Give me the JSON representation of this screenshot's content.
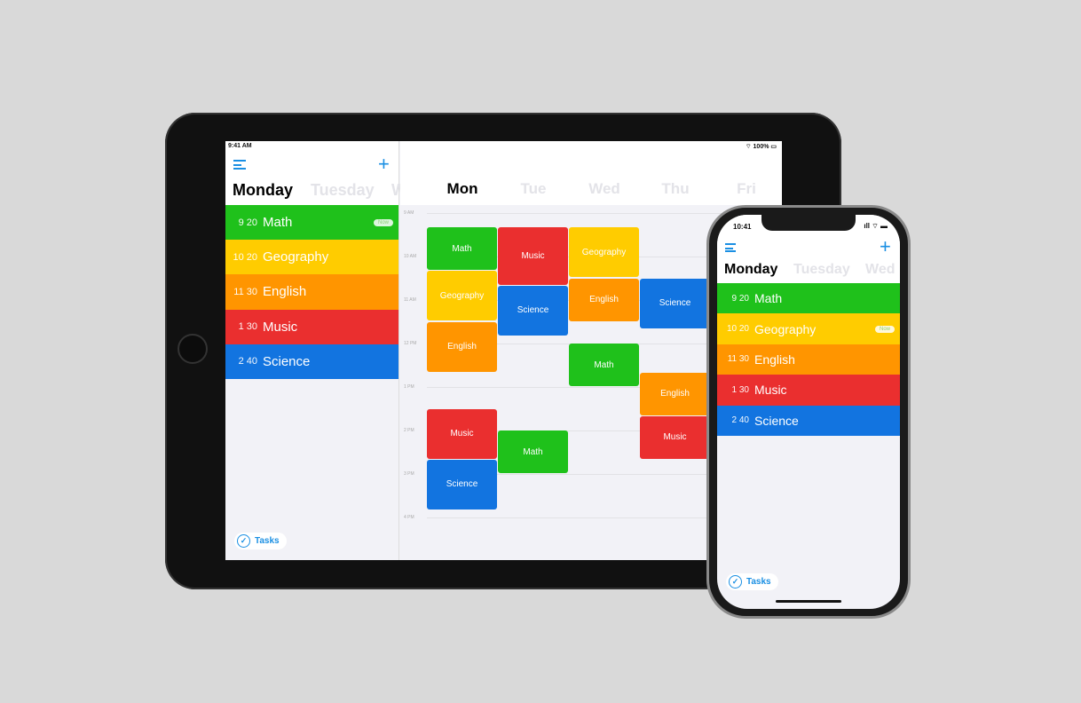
{
  "colors": {
    "math": "#1fc11b",
    "geography": "#ffcc00",
    "english": "#ff9500",
    "music": "#ea2f2f",
    "science": "#1274e0",
    "accent": "#1a8fe3"
  },
  "tablet": {
    "status": {
      "time": "9:41 AM",
      "battery": "100%"
    },
    "days": [
      "Monday",
      "Tuesday",
      "W"
    ],
    "list": [
      {
        "time": "9 20",
        "name": "Math",
        "color": "#1fc11b",
        "badge": "Now"
      },
      {
        "time": "10 20",
        "name": "Geography",
        "color": "#ffcc00"
      },
      {
        "time": "11 30",
        "name": "English",
        "color": "#ff9500"
      },
      {
        "time": "1 30",
        "name": "Music",
        "color": "#ea2f2f"
      },
      {
        "time": "2 40",
        "name": "Science",
        "color": "#1274e0"
      }
    ],
    "tasks_label": "Tasks",
    "week": {
      "columns": [
        "Mon",
        "Tue",
        "Wed",
        "Thu",
        "Fri"
      ],
      "hours": [
        "9 AM",
        "10 AM",
        "11 AM",
        "12 PM",
        "1 PM",
        "2 PM",
        "3 PM",
        "4 PM"
      ],
      "blocks": [
        {
          "day": 0,
          "name": "Math",
          "start": "9:20",
          "end": "10:20",
          "color": "#1fc11b"
        },
        {
          "day": 0,
          "name": "Geography",
          "start": "10:20",
          "end": "11:30",
          "color": "#ffcc00"
        },
        {
          "day": 0,
          "name": "English",
          "start": "11:30",
          "end": "12:40",
          "color": "#ff9500"
        },
        {
          "day": 0,
          "name": "Music",
          "start": "13:30",
          "end": "14:40",
          "color": "#ea2f2f"
        },
        {
          "day": 0,
          "name": "Science",
          "start": "14:40",
          "end": "15:50",
          "color": "#1274e0"
        },
        {
          "day": 1,
          "name": "Music",
          "start": "9:20",
          "end": "10:40",
          "color": "#ea2f2f"
        },
        {
          "day": 1,
          "name": "Science",
          "start": "10:40",
          "end": "11:50",
          "color": "#1274e0"
        },
        {
          "day": 1,
          "name": "Math",
          "start": "14:00",
          "end": "15:00",
          "color": "#1fc11b"
        },
        {
          "day": 2,
          "name": "Geography",
          "start": "9:20",
          "end": "10:30",
          "color": "#ffcc00"
        },
        {
          "day": 2,
          "name": "English",
          "start": "10:30",
          "end": "11:30",
          "color": "#ff9500"
        },
        {
          "day": 2,
          "name": "Math",
          "start": "12:00",
          "end": "13:00",
          "color": "#1fc11b"
        },
        {
          "day": 3,
          "name": "Science",
          "start": "10:30",
          "end": "11:40",
          "color": "#1274e0"
        },
        {
          "day": 3,
          "name": "English",
          "start": "12:40",
          "end": "13:40",
          "color": "#ff9500"
        },
        {
          "day": 3,
          "name": "Music",
          "start": "13:40",
          "end": "14:40",
          "color": "#ea2f2f"
        }
      ]
    }
  },
  "phone": {
    "status": {
      "time": "10:41"
    },
    "days": [
      "Monday",
      "Tuesday",
      "Wed"
    ],
    "list": [
      {
        "time": "9 20",
        "name": "Math",
        "color": "#1fc11b"
      },
      {
        "time": "10 20",
        "name": "Geography",
        "color": "#ffcc00",
        "badge": "Now"
      },
      {
        "time": "11 30",
        "name": "English",
        "color": "#ff9500"
      },
      {
        "time": "1 30",
        "name": "Music",
        "color": "#ea2f2f"
      },
      {
        "time": "2 40",
        "name": "Science",
        "color": "#1274e0"
      }
    ],
    "tasks_label": "Tasks"
  }
}
